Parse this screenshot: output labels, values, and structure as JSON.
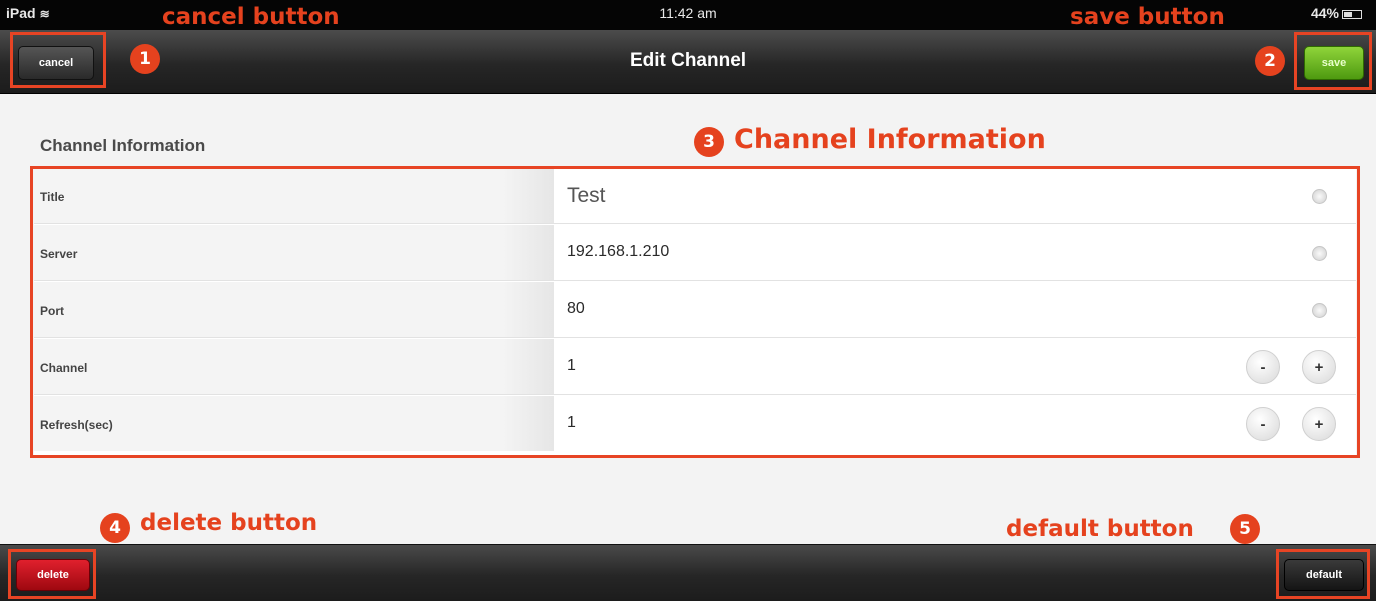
{
  "status_bar": {
    "device": "iPad",
    "wifi_icon": "wifi-icon",
    "time": "11:42 am",
    "battery": "44%",
    "battery_icon": "battery-icon"
  },
  "nav": {
    "title": "Edit Channel",
    "cancel_label": "cancel",
    "save_label": "save"
  },
  "section": {
    "title": "Channel Information"
  },
  "rows": [
    {
      "label": "Title",
      "value": "Test",
      "control": "clear"
    },
    {
      "label": "Server",
      "value": "192.168.1.210",
      "control": "clear"
    },
    {
      "label": "Port",
      "value": "80",
      "control": "clear"
    },
    {
      "label": "Channel",
      "value": "1",
      "control": "stepper"
    },
    {
      "label": "Refresh(sec)",
      "value": "1",
      "control": "stepper"
    }
  ],
  "stepper": {
    "minus": "-",
    "plus": "+"
  },
  "bottom": {
    "delete_label": "delete",
    "default_label": "default"
  },
  "annotations": {
    "cancel": {
      "number": "1",
      "text": "cancel button"
    },
    "save": {
      "number": "2",
      "text": "save button"
    },
    "info": {
      "number": "3",
      "text": "Channel Information"
    },
    "delete": {
      "number": "4",
      "text": "delete button"
    },
    "default": {
      "number": "5",
      "text": "default button"
    }
  },
  "colors": {
    "annotation": "#e5421e",
    "save_button": "#6cb81f",
    "delete_button": "#c2121c"
  }
}
